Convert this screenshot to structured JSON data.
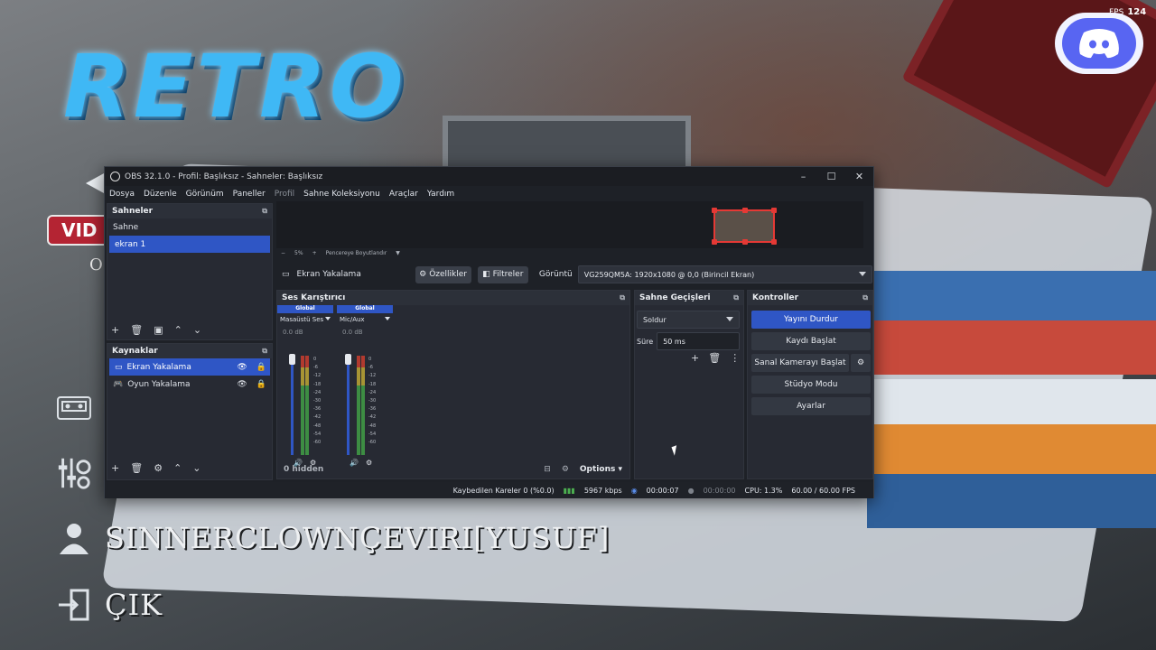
{
  "fps": {
    "label": "FPS",
    "value": "124"
  },
  "game": {
    "title": "RETRO",
    "badge": "VID",
    "subtitle_letter": "O",
    "username": "SINNERCLOWNÇEVIRI[YUSUF]",
    "exit": "ÇIK"
  },
  "obs": {
    "title": "OBS 32.1.0 - Profil: Başlıksız - Sahneler: Başlıksız",
    "menu": [
      "Dosya",
      "Düzenle",
      "Görünüm",
      "Paneller",
      "Profil",
      "Sahne Koleksiyonu",
      "Araçlar",
      "Yardım"
    ],
    "zoom": {
      "minus": "−",
      "value": "5%",
      "plus": "+",
      "fit": "Pencereye Boyutlandır"
    },
    "scenes": {
      "header": "Sahneler",
      "items": [
        "Sahne",
        "ekran 1"
      ],
      "selected": 1
    },
    "sources": {
      "header": "Kaynaklar",
      "items": [
        "Ekran Yakalama",
        "Oyun Yakalama"
      ],
      "selected": 0
    },
    "source_bar": {
      "name": "Ekran Yakalama",
      "properties": "Özellikler",
      "filters": "Filtreler",
      "display_label": "Görüntü",
      "display_value": "VG259QM5A: 1920x1080 @ 0,0 (Birincil Ekran)"
    },
    "mixer": {
      "header": "Ses Karıştırıcı",
      "channels": [
        {
          "global": "Global",
          "name": "Masaüstü Ses",
          "db": "0.0 dB"
        },
        {
          "global": "Global",
          "name": "Mic/Aux",
          "db": "0.0 dB"
        }
      ],
      "scale": [
        "0",
        "-6",
        "-12",
        "-18",
        "-24",
        "-30",
        "-36",
        "-42",
        "-48",
        "-54",
        "-60"
      ],
      "hidden": "0 hidden",
      "options": "Options"
    },
    "transitions": {
      "header": "Sahne Geçişleri",
      "type": "Soldur",
      "duration_label": "Süre",
      "duration_value": "50 ms"
    },
    "controls": {
      "header": "Kontroller",
      "buttons": [
        "Yayını Durdur",
        "Kaydı Başlat",
        "Sanal Kamerayı Başlat",
        "Stüdyo Modu",
        "Ayarlar"
      ]
    },
    "status": {
      "dropped": "Kaybedilen Kareler 0 (%0.0)",
      "bitrate": "5967 kbps",
      "stream_time": "00:00:07",
      "rec_time": "00:00:00",
      "cpu": "CPU: 1.3%",
      "fps": "60.00 / 60.00 FPS"
    }
  },
  "colors": {
    "accent": "#2f56c5",
    "panel": "#272a33",
    "recording_border": "#e53935"
  }
}
